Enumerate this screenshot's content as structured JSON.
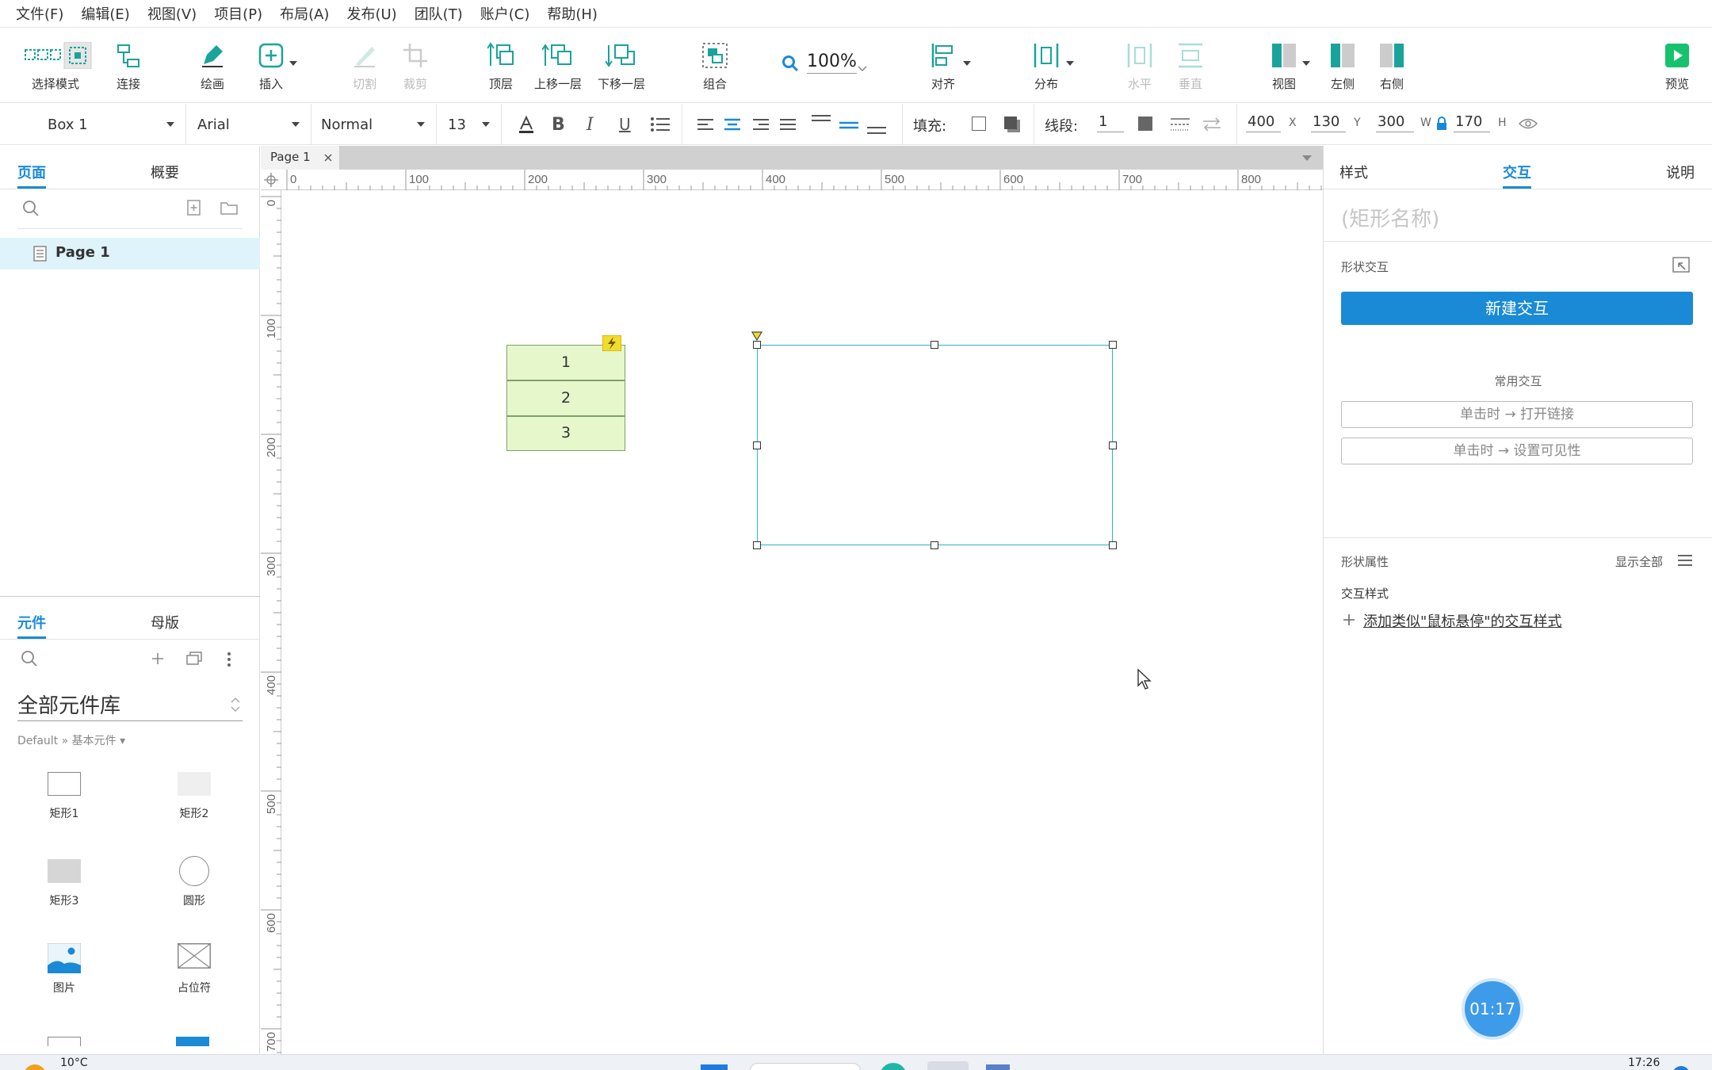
{
  "menu": [
    "文件(F)",
    "编辑(E)",
    "视图(V)",
    "项目(P)",
    "布局(A)",
    "发布(U)",
    "团队(T)",
    "账户(C)",
    "帮助(H)"
  ],
  "toolbar": {
    "select_mode": "选择模式",
    "connect": "连接",
    "draw": "绘画",
    "insert": "插入",
    "cut": "切割",
    "crop": "裁剪",
    "top": "顶层",
    "up": "上移一层",
    "down": "下移一层",
    "group": "组合",
    "zoom": "100%",
    "align": "对齐",
    "distribute": "分布",
    "horizontal": "水平",
    "vertical": "垂直",
    "view": "视图",
    "left": "左侧",
    "right": "右侧",
    "preview": "预览"
  },
  "format": {
    "widget_name": "Box 1",
    "font": "Arial",
    "style": "Normal",
    "size": "13",
    "fill_label": "填充:",
    "stroke_label": "线段:",
    "stroke_value": "1",
    "x": "400",
    "x_unit": "X",
    "y": "130",
    "y_unit": "Y",
    "w": "300",
    "w_unit": "W",
    "h": "170",
    "h_unit": "H"
  },
  "left": {
    "tab_pages": "页面",
    "tab_outline": "概要",
    "page_item": "Page 1",
    "tab_widgets": "元件",
    "tab_masters": "母版",
    "library": "全部元件库",
    "breadcrumb": "Default » 基本元件 ▾",
    "widgets": [
      "矩形1",
      "矩形2",
      "矩形3",
      "圆形",
      "图片",
      "占位符"
    ]
  },
  "canvas": {
    "page_tab": "Page 1",
    "ruler_h": [
      "0",
      "100",
      "200",
      "300",
      "400",
      "500",
      "600",
      "700",
      "800"
    ],
    "ruler_v": [
      "0",
      "100",
      "200",
      "300",
      "400",
      "500",
      "600",
      "700"
    ],
    "list_items": [
      "1",
      "2",
      "3"
    ]
  },
  "right": {
    "tab_style": "样式",
    "tab_interact": "交互",
    "tab_notes": "说明",
    "shape_name_placeholder": "(矩形名称)",
    "shape_interactions": "形状交互",
    "new_interaction": "新建交互",
    "common": "常用交互",
    "common_1": "单击时 → 打开链接",
    "common_2": "单击时 → 设置可见性",
    "shape_props": "形状属性",
    "show_all": "显示全部",
    "interaction_style": "交互样式",
    "add_style": "添加类似\"鼠标悬停\"的交互样式",
    "timer": "01:17"
  },
  "taskbar": {
    "weather": "10°C",
    "time": "17:26"
  },
  "colors": {
    "accent": "#1a8ad6",
    "teal": "#1aa39a",
    "list_fill": "#e6f7cc",
    "list_border": "#7fa06a",
    "selection": "#29b6c6"
  }
}
